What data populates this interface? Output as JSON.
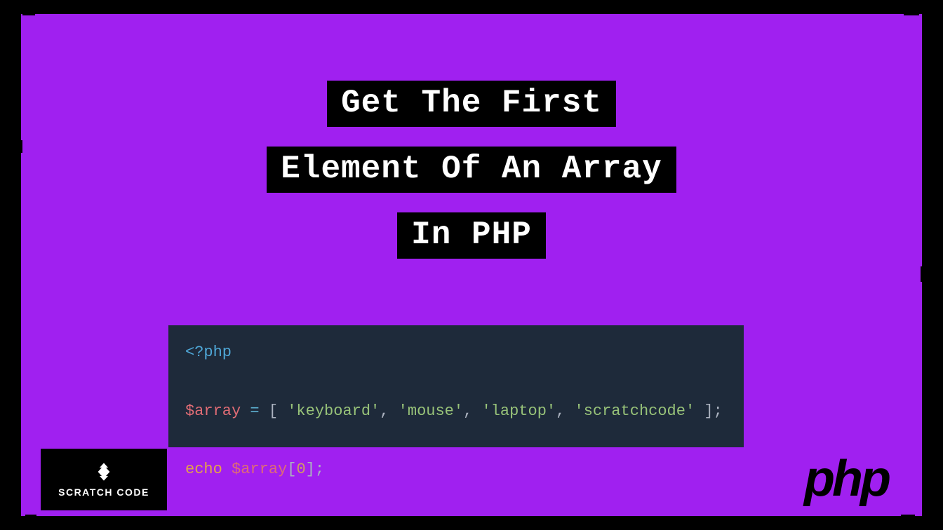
{
  "title": {
    "line1": "Get The First",
    "line2": "Element Of An Array",
    "line3": "In PHP"
  },
  "code": {
    "open_tag": "<?php",
    "var_name": "$array",
    "assign": "=",
    "bracket_open": "[",
    "str1": "'keyboard'",
    "str2": "'mouse'",
    "str3": "'laptop'",
    "str4": "'scratchcode'",
    "bracket_close": "]",
    "semicolon": ";",
    "comma": ",",
    "echo_kw": "echo",
    "index_open": "[",
    "index_num": "0",
    "index_close": "]"
  },
  "logos": {
    "scratch_code": "SCRATCH CODE",
    "php": "php"
  },
  "colors": {
    "background": "#a020f0",
    "code_bg": "#1e2a3a",
    "black": "#000000",
    "white": "#ffffff"
  }
}
